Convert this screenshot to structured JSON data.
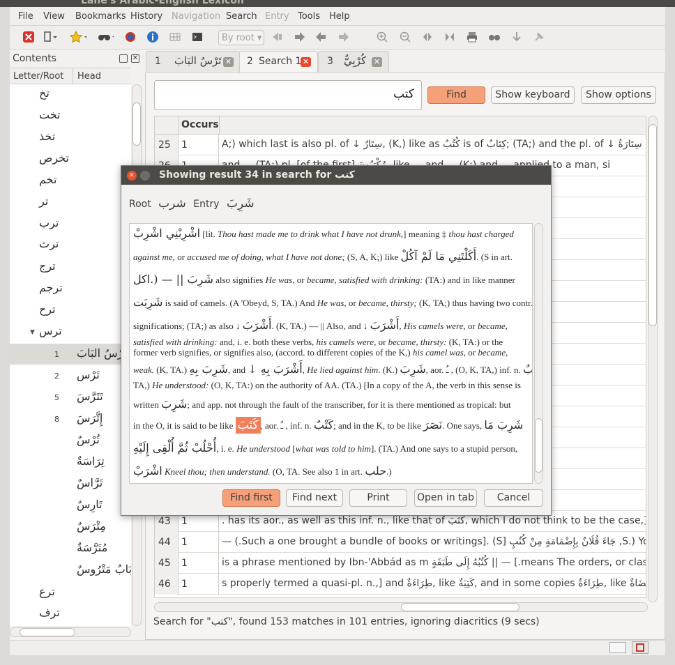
{
  "window": {
    "title": "Lane's Arabic-English Lexicon"
  },
  "menu": {
    "items": [
      {
        "label": "File"
      },
      {
        "label": "View"
      },
      {
        "label": "Bookmarks"
      },
      {
        "label": "History"
      },
      {
        "label": "Navigation"
      },
      {
        "label": "Search"
      },
      {
        "label": "Entry"
      },
      {
        "label": "Tools"
      },
      {
        "label": "Help"
      }
    ]
  },
  "toolbar": {
    "by_root": "By root"
  },
  "contents": {
    "title": "Contents",
    "col_letter_root": "Letter/Root",
    "col_head": "Head",
    "roots": [
      "تخ",
      "تخت",
      "تخذ",
      "تخرص",
      "تخم",
      "تر",
      "ترب",
      "ترث",
      "ترج",
      "ترجم",
      "ترح",
      "ترس"
    ],
    "heads": [
      {
        "num": "1",
        "word": "تَرْسُ البَابَ"
      },
      {
        "num": "2",
        "word": "تَرْس"
      },
      {
        "num": "5",
        "word": "تَتَرَّسَ"
      },
      {
        "num": "8",
        "word": "إِتَّرَسَ"
      },
      {
        "num": "",
        "word": "تُرْسٌ"
      },
      {
        "num": "",
        "word": "تِرَاسَةٌ"
      },
      {
        "num": "",
        "word": "تَرَّاسٌ"
      },
      {
        "num": "",
        "word": "تَارِسٌ"
      },
      {
        "num": "",
        "word": "مِتْرَسٌ"
      },
      {
        "num": "",
        "word": "مُتَرَّسَةٌ"
      },
      {
        "num": "",
        "word": "بَابٌ مَتْرُوسٌ"
      }
    ],
    "roots_after": [
      "ترع",
      "ترف"
    ]
  },
  "tabs": [
    {
      "num": "1",
      "label": "تَرْسُ البَابَ"
    },
    {
      "num": "2",
      "label": "Search 1"
    },
    {
      "num": "3",
      "label": "كُرْبِيٌّ"
    }
  ],
  "search": {
    "query": "كتب",
    "find": "Find",
    "show_keyboard": "Show keyboard",
    "show_options": "Show options"
  },
  "results": {
    "col_occurs": "Occurs",
    "rows": [
      {
        "n": "25",
        "occurs": "1",
        "text": "A;) which last is also pl. of ↓ سِتَارٌ, (K,) like as كُتُبٌ is of كِتَابٌ; (TA;) and the pl. of ↓ سِتَارَةٌ is سَتَائِر"
      },
      {
        "n": "26",
        "occurs": "1",
        "text": "and ... (TA;) pl. [of the first] مُكْتِبُونَ, like ... and ... (K;) and ... applied to a man, si"
      },
      {
        "n": "27",
        "occurs": "1",
        "text": ""
      },
      {
        "n": "28",
        "occurs": "1",
        "text": "e of writing]: (A:) a"
      },
      {
        "n": "29",
        "occurs": "1",
        "text": "سَلَاسِبُ and سَلَاسِبُ (M, K:"
      },
      {
        "n": "30",
        "occurs": "1",
        "text": "Msb;) the latter origin"
      },
      {
        "n": "31",
        "occurs": "1",
        "text": "(K, [in a copy of ... مُؤْدِّب"
      },
      {
        "n": "32",
        "occurs": "1",
        "text": "e art of writing is ta"
      },
      {
        "n": "33",
        "occurs": "1",
        "text": "mmencing of books,"
      },
      {
        "n": "34",
        "occurs": "1",
        "text": "; and in the K, to be"
      },
      {
        "n": "35",
        "occurs": "1",
        "text": "e in poetry, (O,) or th"
      },
      {
        "n": "36",
        "occurs": "1",
        "text": "is a mistranscription"
      },
      {
        "n": "37",
        "occurs": "1",
        "text": "y said in the K to be l"
      },
      {
        "n": "38",
        "occurs": "1",
        "text": "eaning † [I wrote a le"
      },
      {
        "n": "39",
        "occurs": "1",
        "text": ""
      },
      {
        "n": "40",
        "occurs": "1",
        "text": "upon the two sides,"
      },
      {
        "n": "41",
        "occurs": "1",
        "text": "sb:) you say, الكِتَابَ"
      },
      {
        "n": "42",
        "occurs": "1",
        "text": "ضُبِطُهُ وَجَعَ || — ‡ A pa"
      },
      {
        "n": "43",
        "occurs": "1",
        "text": ". has its aor., as well as this inf. n., like that of كَتَبَ, which I do not think to be the case,] The"
      },
      {
        "n": "44",
        "occurs": "1",
        "text": "— (.Such a one brought a bundle of books or writings]. (S] جَاءَ فُلَانٌ بِإِضْمَامَةٍ مِنْ كُتُبٍ ,S.) You s"
      },
      {
        "n": "45",
        "occurs": "1",
        "text": "is a phrase mentioned by Ibn-'Abbád as m كُتُبُهُ إِلَى طَبَقَةٍ || — [.means The orders, or classes, o"
      },
      {
        "n": "46",
        "occurs": "1",
        "text": "s properly termed a quasi-pl. n.,] and طِرَاءَةٌ, like كَتِبَةٌ, and in some copies طِرَاءَةٌ, like قُضَاةٌ: (TA:) an"
      }
    ],
    "status": "Search for \"كتب\", found 153 matches in 101 entries, ignoring diacritics (9 secs)"
  },
  "dialog": {
    "title": "Showing result 34 in search for كتب",
    "root_label": "Root",
    "root_value": "شرب",
    "entry_label": "Entry",
    "entry_value": "شَرِبَ",
    "lines": [
      {
        "a": "اشْرِبْنِي اشْرِبْ",
        "b": " [lit. ",
        "i1": "Thou hast made me to drink what I have not drunk,",
        "c": "] meaning ‡ ",
        "i2": "thou hast charged"
      },
      {
        "i1": "against me,",
        "b": " or ",
        "i2": "accused me of doing, what I have not done;",
        "c": " (S, A, K;) like ",
        "a": "أَكَلْتَنِي مَا لَمْ آكُلْ",
        "d": ". (S in art."
      },
      {
        "a": "شَرِبَ || — (.اكل",
        "b": " also signifies ",
        "i1": "He was,",
        "c": " or ",
        "i2": "became, satisfied with drinking:",
        "d": " (TA:) and in like manner"
      },
      {
        "a": "شَرِبَت",
        "b": " is said of camels. (A 'Obeyd, S, TA.) And ",
        "i1": "He was,",
        "c": " or ",
        "i2": "became, thirsty;",
        "d": " (K, TA;) thus having two contr."
      },
      {
        "b": "significations; (TA;) as also ↓ ",
        "a": "أَشْرَبَ",
        "c": ". (K, TA.) — || Also, and ↓ ",
        "a2": "أَشْرَبَ",
        "i1": ", His camels were,",
        "d": " or ",
        "i2": "became,"
      },
      {
        "i1": "satisfied with drinking:",
        "b": " and, i. e. both these verbs, ",
        "i2": "his camels were,",
        "c": " or ",
        "i3": "became, thirsty:",
        "d": " (K, TA:) or the"
      },
      {
        "b": "former verb signifies, or signifies also, (accord. to different copies of the K,) ",
        "i1": "his camel was,",
        "c": " or ",
        "i2": "became,"
      },
      {
        "i1": "weak.",
        "b": " (K, TA.) ",
        "a": "شَرِبَ بِهِ",
        "c": ", and ",
        "a2": "↓ أَشْرَبَ بِهِ",
        "d": ", ",
        "i2": "He lied against him.",
        "e": " (K.) ",
        "a3": "شَرِبَ",
        "f": ", aor. ـُ , (O, K, TA,) inf. n. ",
        "a4": "شُرْبٌ",
        "g": ", (O,"
      },
      {
        "b": "TA,) ",
        "i1": "He understood:",
        "c": " (O, K, TA:) on the authority of AA. (TA.) [In a copy of the A, the verb in this sense is"
      },
      {
        "b": "written ",
        "a": "شَرِبَ",
        "c": "; and app. not through the fault of the transcriber, for it is there mentioned as tropical: but"
      },
      {
        "b": "in the O, it is said to be like ",
        "hl": "كَتَبَ",
        "c": ", aor. ـُ , inf. n. ",
        "a": "كَتْبٌ",
        "d": "; and in the K, to be like ",
        "a2": "نَصَرَ",
        "e": ". One says, ",
        "a3": "شَرِبَ مَا"
      },
      {
        "a": "أُحْلُبْ ثُمَّ أُلْقِى إِلَيْهِ",
        "b": ", i. e. ",
        "i1": "He understood",
        "c": " [",
        "i2": "what was told to him",
        "d": "]. (TA.) And one says to a stupid person, "
      },
      {
        "a": "اشْرَبْ",
        "b": " ",
        "i1": "Kneel thou; then understand.",
        "c": " (O, TA. See also 1 in art. ",
        "a2": "حلب",
        "d": ".)"
      }
    ],
    "buttons": {
      "find_first": "Find first",
      "find_next": "Find next",
      "print": "Print",
      "open_in_tab": "Open in tab",
      "cancel": "Cancel"
    }
  }
}
